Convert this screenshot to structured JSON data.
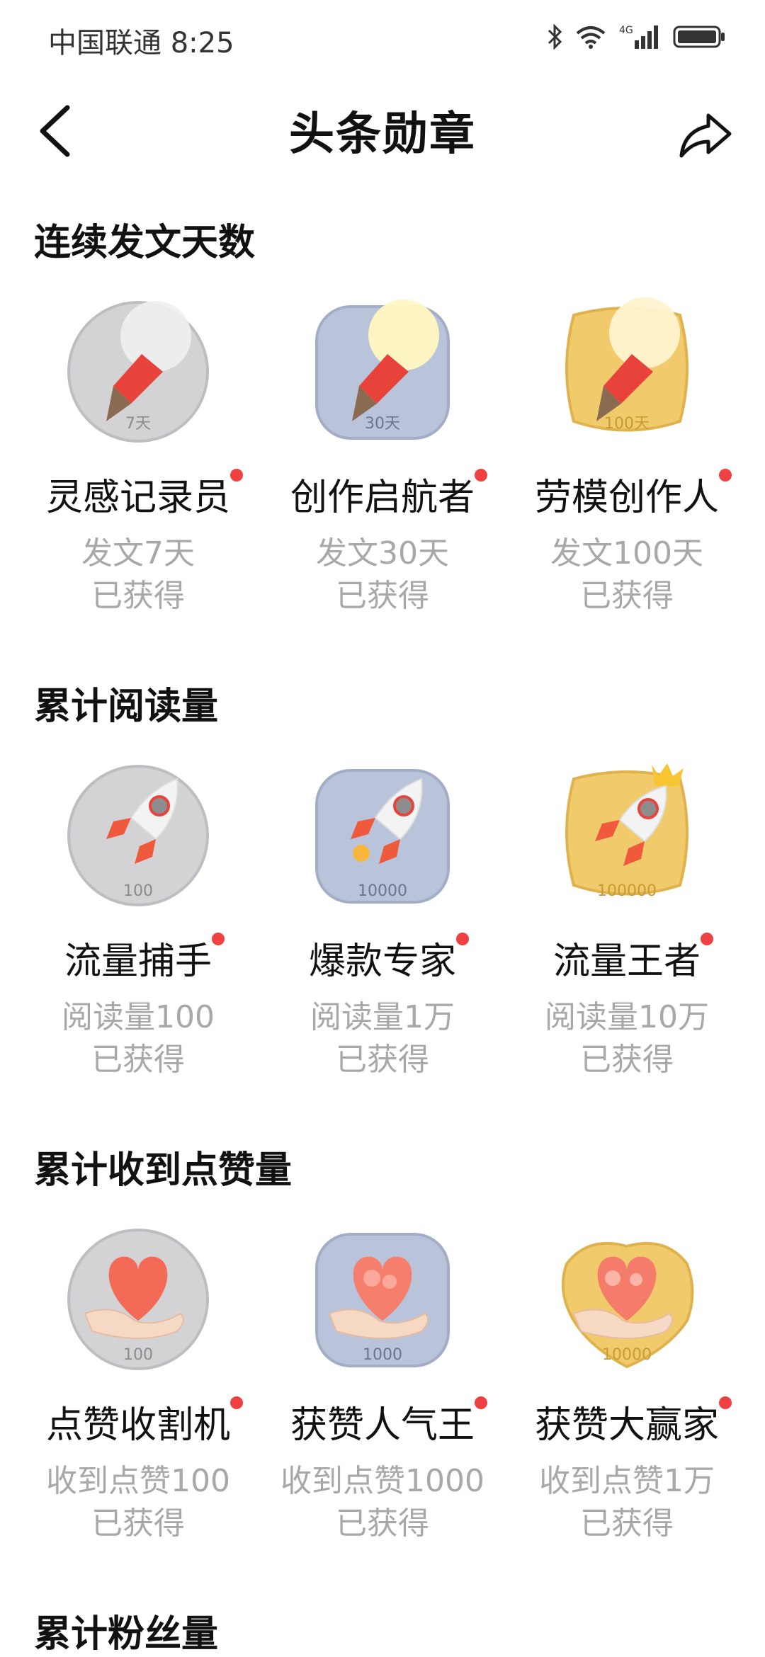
{
  "status_bar": {
    "carrier": "中国联通",
    "time": "8:25",
    "network": "4G"
  },
  "nav": {
    "title": "头条勋章"
  },
  "sections": [
    {
      "title": "连续发文天数",
      "badges": [
        {
          "name": "灵感记录员",
          "desc": "发文7天",
          "status": "已获得",
          "tier": "silver",
          "icon": "lightbulb-pen-icon",
          "icon_label": "7天"
        },
        {
          "name": "创作启航者",
          "desc": "发文30天",
          "status": "已获得",
          "tier": "blue",
          "icon": "lightbulb-pen-icon",
          "icon_label": "30天"
        },
        {
          "name": "劳模创作人",
          "desc": "发文100天",
          "status": "已获得",
          "tier": "gold",
          "icon": "lightbulb-pen-icon",
          "icon_label": "100天"
        }
      ]
    },
    {
      "title": "累计阅读量",
      "badges": [
        {
          "name": "流量捕手",
          "desc": "阅读量100",
          "status": "已获得",
          "tier": "silver",
          "icon": "rocket-icon",
          "icon_label": "100"
        },
        {
          "name": "爆款专家",
          "desc": "阅读量1万",
          "status": "已获得",
          "tier": "blue",
          "icon": "rocket-icon",
          "icon_label": "10000"
        },
        {
          "name": "流量王者",
          "desc": "阅读量10万",
          "status": "已获得",
          "tier": "gold",
          "icon": "rocket-crown-icon",
          "icon_label": "100000"
        }
      ]
    },
    {
      "title": "累计收到点赞量",
      "badges": [
        {
          "name": "点赞收割机",
          "desc": "收到点赞100",
          "status": "已获得",
          "tier": "silver",
          "icon": "heart-hand-icon",
          "icon_label": "100"
        },
        {
          "name": "获赞人气王",
          "desc": "收到点赞1000",
          "status": "已获得",
          "tier": "blue",
          "icon": "heart-hand-icon",
          "icon_label": "1000"
        },
        {
          "name": "获赞大赢家",
          "desc": "收到点赞1万",
          "status": "已获得",
          "tier": "gold",
          "icon": "heart-hand-icon",
          "icon_label": "10000"
        }
      ]
    },
    {
      "title": "累计粉丝量",
      "badges": []
    }
  ],
  "tier_colors": {
    "silver": "#d3d3d6",
    "blue": "#b9c3d9",
    "gold": "#f1cb6b",
    "red_dot": "#f04142",
    "rocket_red": "#f05a3c"
  }
}
